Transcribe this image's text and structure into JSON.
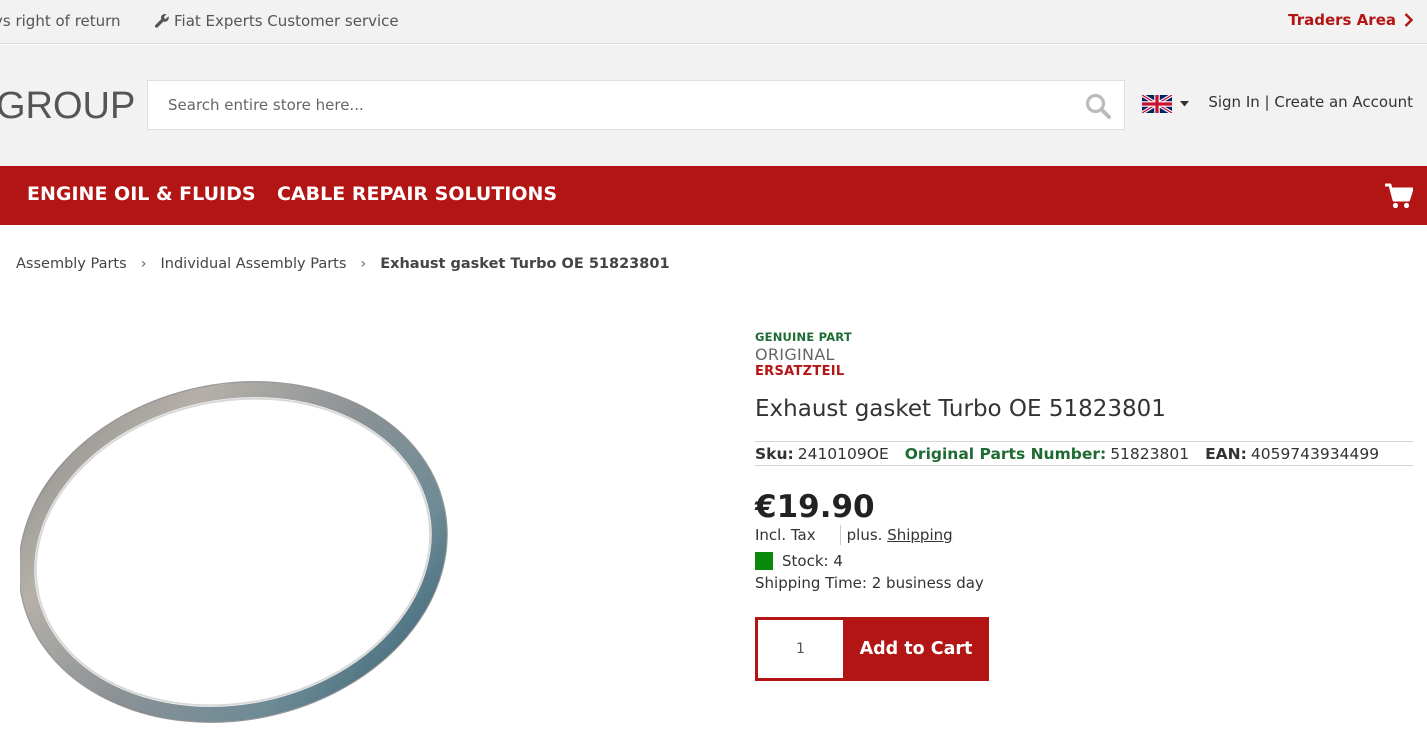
{
  "topbar": {
    "return_notice": "ys right of return",
    "service_notice": "Fiat Experts Customer service",
    "service_icon": "wrench-icon",
    "traders_link": "Traders Area",
    "traders_icon": "chevron-right-icon"
  },
  "header": {
    "logo_text": "GROUP",
    "search_placeholder": "Search entire store here...",
    "search_icon": "search-icon",
    "language_icon": "uk-flag-icon",
    "account_text": "Sign In | Create an Account"
  },
  "nav": {
    "items": [
      "ENGINE OIL & FLUIDS",
      "CABLE REPAIR SOLUTIONS"
    ],
    "cart_icon": "cart-icon"
  },
  "breadcrumb": {
    "items": [
      "Assembly Parts",
      "Individual Assembly Parts"
    ],
    "separator": "›",
    "current": "Exhaust gasket Turbo OE 51823801"
  },
  "product": {
    "badge": {
      "line1": "GENUINE PART",
      "line2": "ORIGINAL",
      "line3": "ERSATZTEIL"
    },
    "title": "Exhaust gasket Turbo OE 51823801",
    "sku_label": "Sku:",
    "sku_value": "2410109OE",
    "oe_label": "Original Parts Number:",
    "oe_value": "51823801",
    "ean_label": "EAN:",
    "ean_value": "4059743934499",
    "price": "€19.90",
    "tax_label": "Incl. Tax",
    "shipping_prefix": "plus.",
    "shipping_link": "Shipping",
    "stock_text": "Stock: 4",
    "shipping_time": "Shipping Time: 2 business day",
    "qty_value": "1",
    "add_to_cart": "Add to Cart"
  },
  "colors": {
    "brand_red": "#b31414",
    "genuine_green": "#1f6b34",
    "stock_green": "#0a8a0a"
  }
}
